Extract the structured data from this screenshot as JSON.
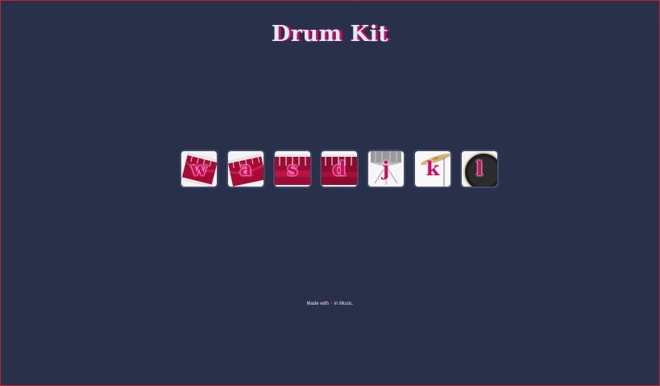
{
  "title": "Drum Kit",
  "drums": [
    {
      "key": "w",
      "icon": "crash-drum-icon"
    },
    {
      "key": "a",
      "icon": "kick-drum-icon"
    },
    {
      "key": "s",
      "icon": "snare-drum-icon"
    },
    {
      "key": "d",
      "icon": "tom-drum-icon"
    },
    {
      "key": "j",
      "icon": "hi-hat-icon"
    },
    {
      "key": "k",
      "icon": "cymbal-icon"
    },
    {
      "key": "l",
      "icon": "bass-drum-icon"
    }
  ],
  "footer": {
    "prefix": "Made with",
    "heart": "♥",
    "suffix": "in Music."
  },
  "colors": {
    "background": "#283149",
    "title": "#dbedf3",
    "accent": "#da0463",
    "border": "#404b69"
  }
}
